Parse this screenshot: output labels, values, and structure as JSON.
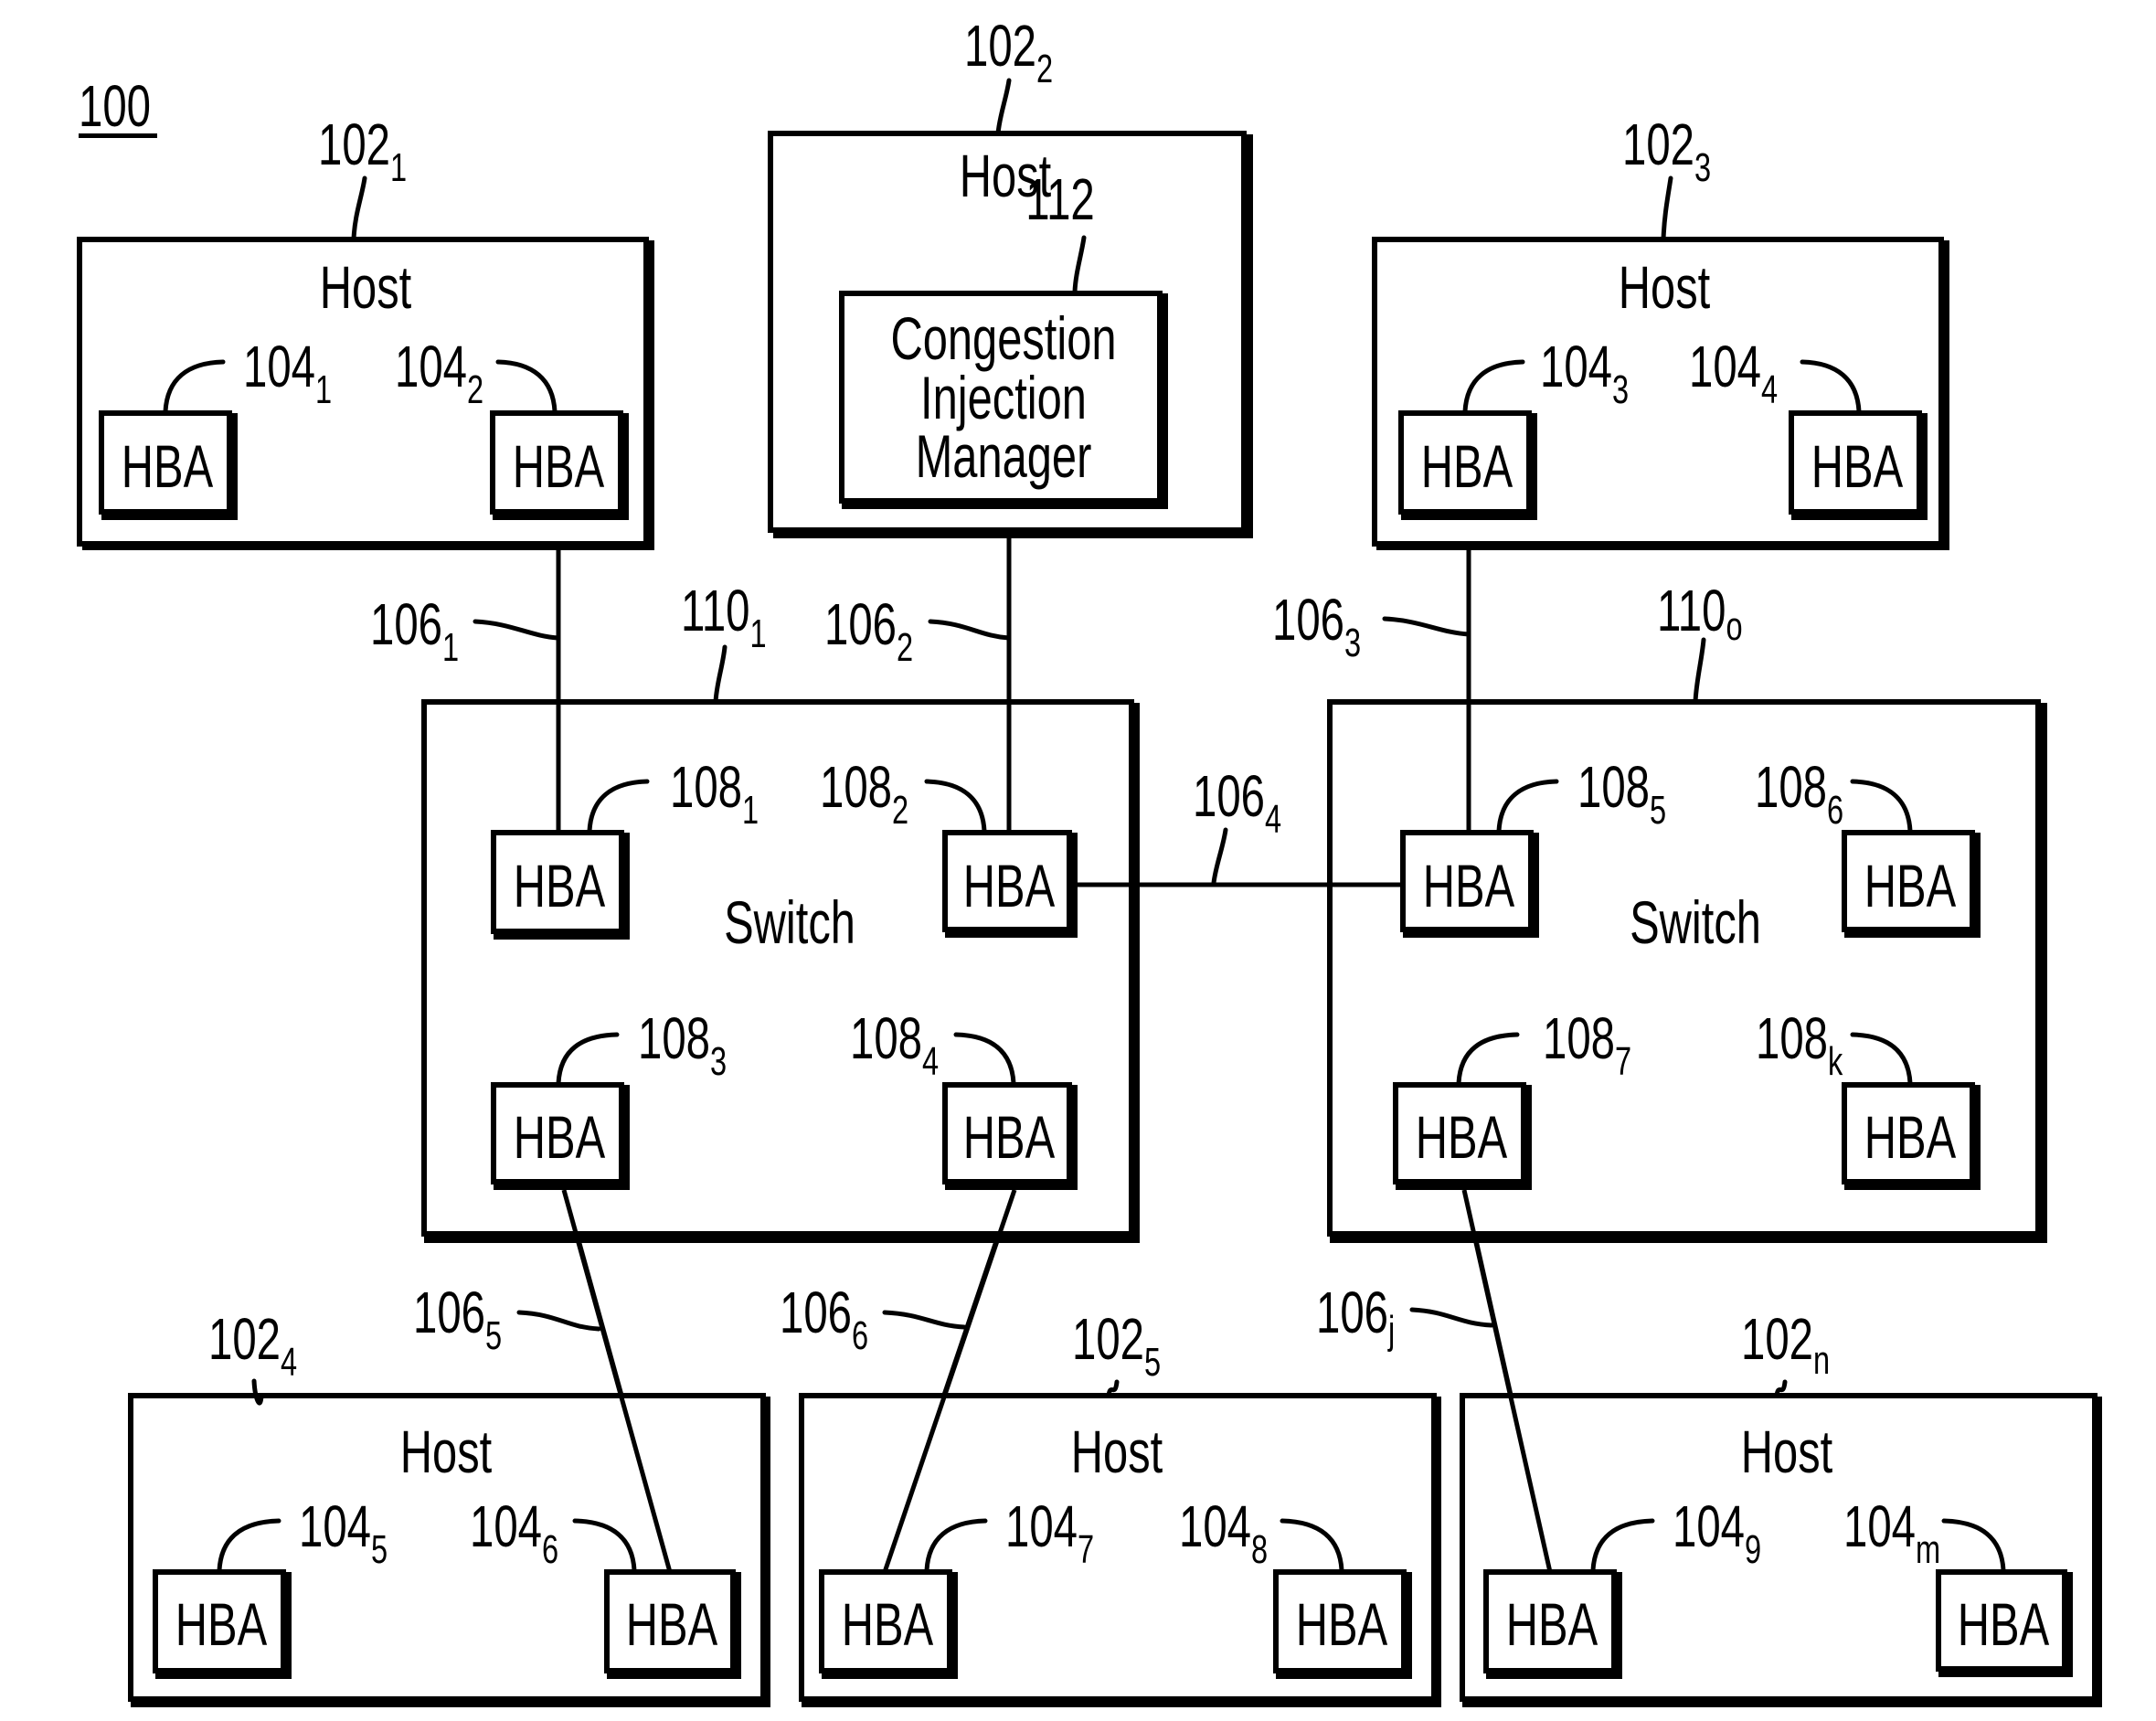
{
  "figure": {
    "label": "100"
  },
  "hosts": [
    {
      "id": "host-102-1",
      "title": "Host",
      "ref": "102",
      "ref_sub": "1",
      "hbas": [
        {
          "label": "HBA",
          "ref": "104",
          "ref_sub": "1"
        },
        {
          "label": "HBA",
          "ref": "104",
          "ref_sub": "2"
        }
      ]
    },
    {
      "id": "host-102-2",
      "title": "Host",
      "ref": "102",
      "ref_sub": "2",
      "component": {
        "lines": [
          "Congestion",
          "Injection",
          "Manager"
        ],
        "ref": "112"
      }
    },
    {
      "id": "host-102-3",
      "title": "Host",
      "ref": "102",
      "ref_sub": "3",
      "hbas": [
        {
          "label": "HBA",
          "ref": "104",
          "ref_sub": "3"
        },
        {
          "label": "HBA",
          "ref": "104",
          "ref_sub": "4"
        }
      ]
    },
    {
      "id": "host-102-4",
      "title": "Host",
      "ref": "102",
      "ref_sub": "4",
      "hbas": [
        {
          "label": "HBA",
          "ref": "104",
          "ref_sub": "5"
        },
        {
          "label": "HBA",
          "ref": "104",
          "ref_sub": "6"
        }
      ]
    },
    {
      "id": "host-102-5",
      "title": "Host",
      "ref": "102",
      "ref_sub": "5",
      "hbas": [
        {
          "label": "HBA",
          "ref": "104",
          "ref_sub": "7"
        },
        {
          "label": "HBA",
          "ref": "104",
          "ref_sub": "8"
        }
      ]
    },
    {
      "id": "host-102-n",
      "title": "Host",
      "ref": "102",
      "ref_sub": "n",
      "hbas": [
        {
          "label": "HBA",
          "ref": "104",
          "ref_sub": "9"
        },
        {
          "label": "HBA",
          "ref": "104",
          "ref_sub": "m"
        }
      ]
    }
  ],
  "switches": [
    {
      "id": "switch-110-1",
      "title": "Switch",
      "ref": "110",
      "ref_sub": "1",
      "hbas": [
        {
          "label": "HBA",
          "ref": "108",
          "ref_sub": "1"
        },
        {
          "label": "HBA",
          "ref": "108",
          "ref_sub": "2"
        },
        {
          "label": "HBA",
          "ref": "108",
          "ref_sub": "3"
        },
        {
          "label": "HBA",
          "ref": "108",
          "ref_sub": "4"
        }
      ]
    },
    {
      "id": "switch-110-o",
      "title": "Switch",
      "ref": "110",
      "ref_sub": "o",
      "hbas": [
        {
          "label": "HBA",
          "ref": "108",
          "ref_sub": "5"
        },
        {
          "label": "HBA",
          "ref": "108",
          "ref_sub": "6"
        },
        {
          "label": "HBA",
          "ref": "108",
          "ref_sub": "7"
        },
        {
          "label": "HBA",
          "ref": "108",
          "ref_sub": "k"
        }
      ]
    }
  ],
  "links": [
    {
      "ref": "106",
      "ref_sub": "1",
      "from": "HBA 104_2",
      "to": "HBA 108_1"
    },
    {
      "ref": "106",
      "ref_sub": "2",
      "from": "Congestion Injection Manager",
      "to": "HBA 108_2"
    },
    {
      "ref": "106",
      "ref_sub": "3",
      "from": "HBA 104_3",
      "to": "HBA 108_5"
    },
    {
      "ref": "106",
      "ref_sub": "4",
      "from": "HBA 108_2",
      "to": "HBA 108_5"
    },
    {
      "ref": "106",
      "ref_sub": "5",
      "from": "HBA 108_3",
      "to": "HBA 104_6"
    },
    {
      "ref": "106",
      "ref_sub": "6",
      "from": "HBA 108_4",
      "to": "HBA 104_7"
    },
    {
      "ref": "106",
      "ref_sub": "j",
      "from": "HBA 108_7",
      "to": "HBA 104_9"
    }
  ]
}
